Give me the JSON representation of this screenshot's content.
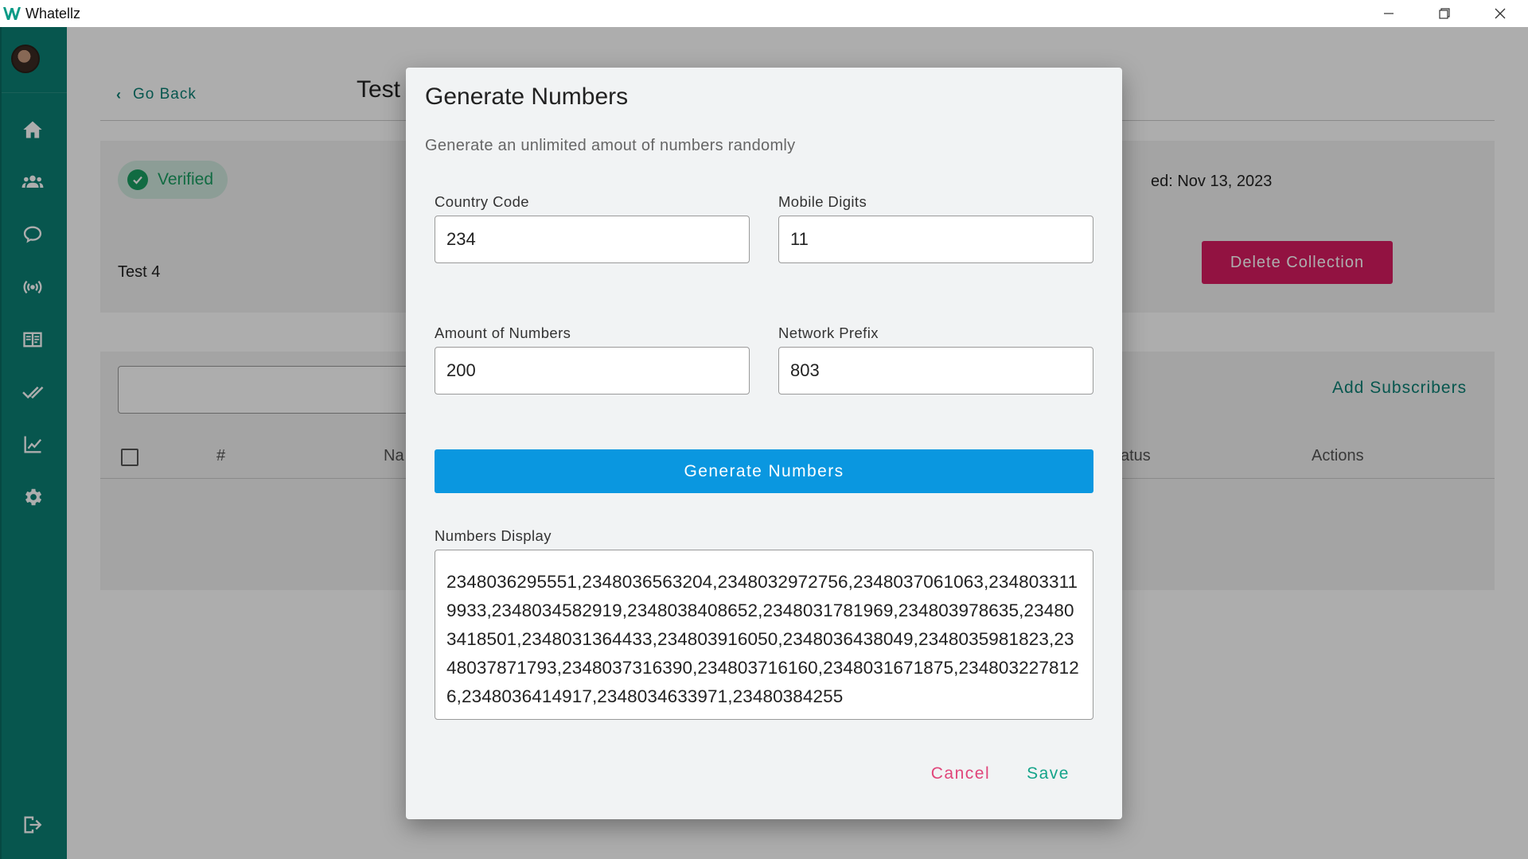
{
  "window": {
    "title": "Whatellz"
  },
  "page": {
    "back_label": "Go Back",
    "title": "Test",
    "verified_label": "Verified",
    "description": "Test 4",
    "created_text": "ed: Nov 13, 2023",
    "delete_label": "Delete Collection",
    "add_subscribers_label": "Add Subscribers",
    "table_headers": {
      "index": "#",
      "name": "Na",
      "status": "atus",
      "actions": "Actions"
    }
  },
  "sidebar": {
    "items": [
      "home-icon",
      "groups-icon",
      "chat-icon",
      "broadcast-icon",
      "contacts-book-icon",
      "double-check-icon",
      "analytics-icon",
      "settings-icon"
    ],
    "logout": "logout-icon"
  },
  "dialog": {
    "title": "Generate Numbers",
    "subtitle": "Generate an unlimited amout of numbers randomly",
    "country_code": {
      "label": "Country Code",
      "value": "234"
    },
    "mobile_digits": {
      "label": "Mobile Digits",
      "value": "11"
    },
    "amount": {
      "label": "Amount of Numbers",
      "value": "200"
    },
    "network_prefix": {
      "label": "Network Prefix",
      "value": "803"
    },
    "generate_label": "Generate Numbers",
    "numbers_label": "Numbers Display",
    "numbers_value": "2348036295551,2348036563204,2348032972756,2348037061063,2348033119933,2348034582919,2348038408652,2348031781969,234803978635,234803418501,2348031364433,234803916050,2348036438049,2348035981823,2348037871793,2348037316390,234803716160,2348031671875,2348032278126,2348036414917,2348034633971,23480384255",
    "cancel_label": "Cancel",
    "save_label": "Save"
  },
  "colors": {
    "sidebar": "#0b7f74",
    "primary_button": "#0a97e0",
    "delete_button": "#d81b60",
    "cancel": "#e0457a",
    "save": "#14a48a",
    "verified": "#1a9e62"
  }
}
